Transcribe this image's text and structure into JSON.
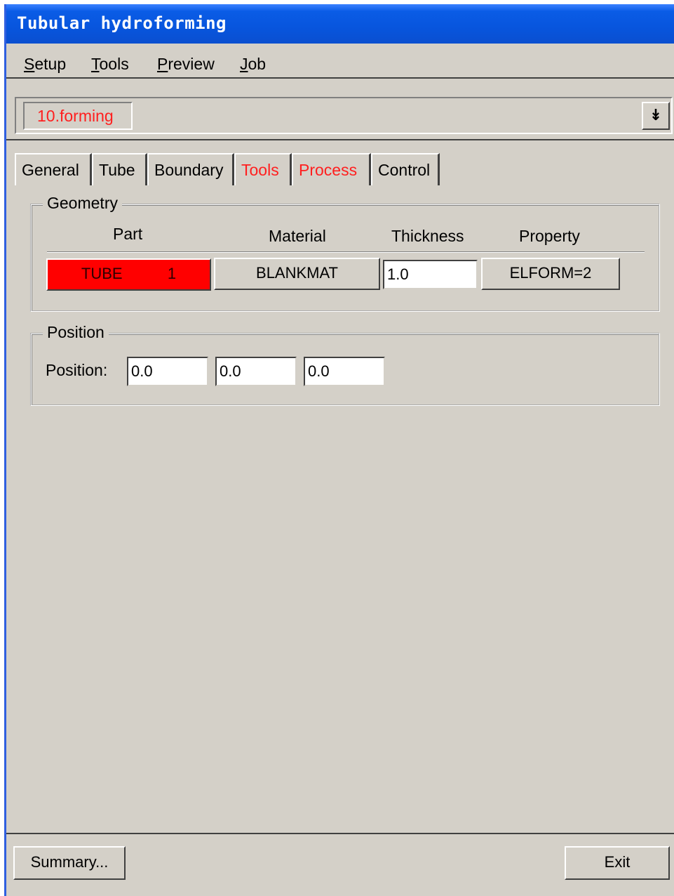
{
  "window": {
    "title": "Tubular hydroforming"
  },
  "menubar": {
    "items": [
      {
        "first": "S",
        "rest": "etup"
      },
      {
        "first": "T",
        "rest": "ools"
      },
      {
        "first": "P",
        "rest": "review"
      },
      {
        "first": "J",
        "rest": "ob"
      }
    ]
  },
  "stage": {
    "current": "10.forming",
    "dropdown_icon": "double-down-arrow"
  },
  "tabs": [
    {
      "label": "General"
    },
    {
      "label": "Tube"
    },
    {
      "label": "Boundary"
    },
    {
      "label": "Tools"
    },
    {
      "label": "Process"
    },
    {
      "label": "Control"
    }
  ],
  "geometry": {
    "legend": "Geometry",
    "headers": {
      "part": "Part",
      "material": "Material",
      "thickness": "Thickness",
      "property": "Property"
    },
    "row": {
      "part_name": "TUBE",
      "part_id": "1",
      "material": "BLANKMAT",
      "thickness": "1.0",
      "property": "ELFORM=2"
    }
  },
  "position": {
    "legend": "Position",
    "label": "Position:",
    "x": "0.0",
    "y": "0.0",
    "z": "0.0"
  },
  "footer": {
    "summary_label": "Summary...",
    "exit_label": "Exit"
  },
  "colors": {
    "highlight_red": "#ff0000",
    "title_blue": "#0a5ce6",
    "panel_gray": "#d4d0c8"
  }
}
